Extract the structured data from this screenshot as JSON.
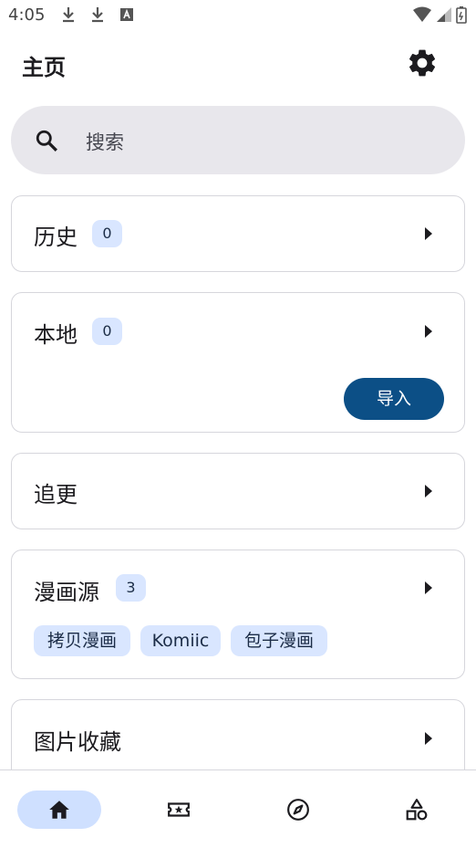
{
  "status_bar": {
    "time": "4:05"
  },
  "app_bar": {
    "title": "主页"
  },
  "search": {
    "placeholder": "搜索"
  },
  "cards": {
    "history": {
      "label": "历史",
      "count": "0"
    },
    "local": {
      "label": "本地",
      "count": "0",
      "import_label": "导入"
    },
    "follow": {
      "label": "追更"
    },
    "sources": {
      "label": "漫画源",
      "count": "3",
      "chips": [
        "拷贝漫画",
        "Komiic",
        "包子漫画"
      ]
    },
    "images": {
      "label": "图片收藏"
    }
  },
  "bottom_nav": {
    "items": [
      {
        "icon": "home-icon",
        "active": true
      },
      {
        "icon": "ticket-star-icon",
        "active": false
      },
      {
        "icon": "compass-icon",
        "active": false
      },
      {
        "icon": "shapes-icon",
        "active": false
      }
    ]
  },
  "colors": {
    "accent": "#0c4f86",
    "badge_bg": "#d9e6ff",
    "search_bg": "#e8e7ec"
  }
}
